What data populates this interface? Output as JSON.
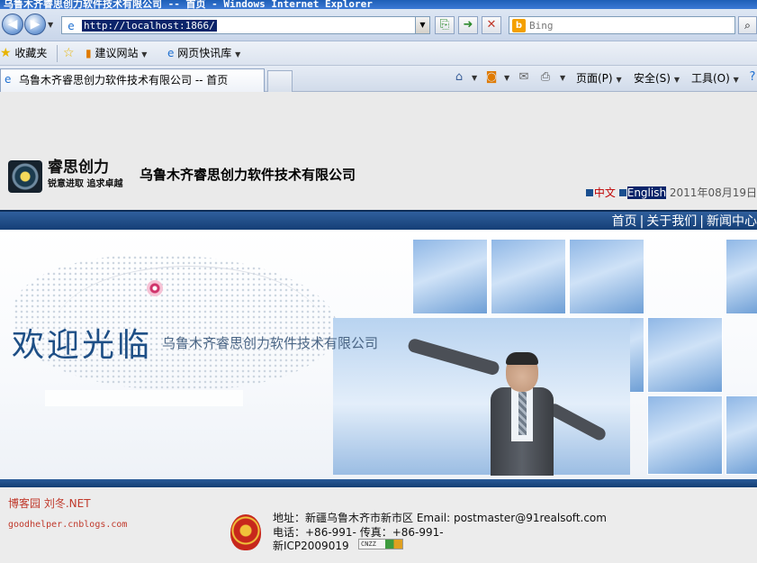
{
  "window": {
    "title": "乌鲁木齐睿思创力软件技术有限公司 -- 首页 - Windows Internet Explorer"
  },
  "addressbar": {
    "url": "http://localhost:1866/",
    "search_placeholder": "Bing"
  },
  "favorites_bar": {
    "favorites_label": "收藏夹",
    "items": [
      {
        "label": "建议网站"
      },
      {
        "label": "网页快讯库"
      }
    ]
  },
  "tabs": {
    "active_title": "乌鲁木齐睿思创力软件技术有限公司 -- 首页"
  },
  "command_bar": {
    "page_label": "页面(P)",
    "safety_label": "安全(S)",
    "tools_label": "工具(O)"
  },
  "site": {
    "logo": {
      "name": "睿思创力",
      "slogan": "锐意进取 追求卓越"
    },
    "company_name": "乌鲁木齐睿思创力软件技术有限公司",
    "language": {
      "chinese": "中文",
      "english": "English",
      "date": "2011年08月19日"
    },
    "nav": {
      "items": [
        "首页",
        "关于我们",
        "新闻中心"
      ]
    },
    "banner": {
      "welcome": "欢迎光临",
      "subtitle": "乌鲁木齐睿思创力软件技术有限公司"
    },
    "footer": {
      "blog_name": "博客园 刘冬.NET",
      "blog_url": "goodhelper.cnblogs.com",
      "address_line": "地址：新疆乌鲁木齐市新市区  Email: postmaster@91realsoft.com",
      "phone_line": "电话：+86-991-  传真：+86-991-",
      "icp": "新ICP2009019",
      "cnzz": "CNZZ"
    }
  }
}
